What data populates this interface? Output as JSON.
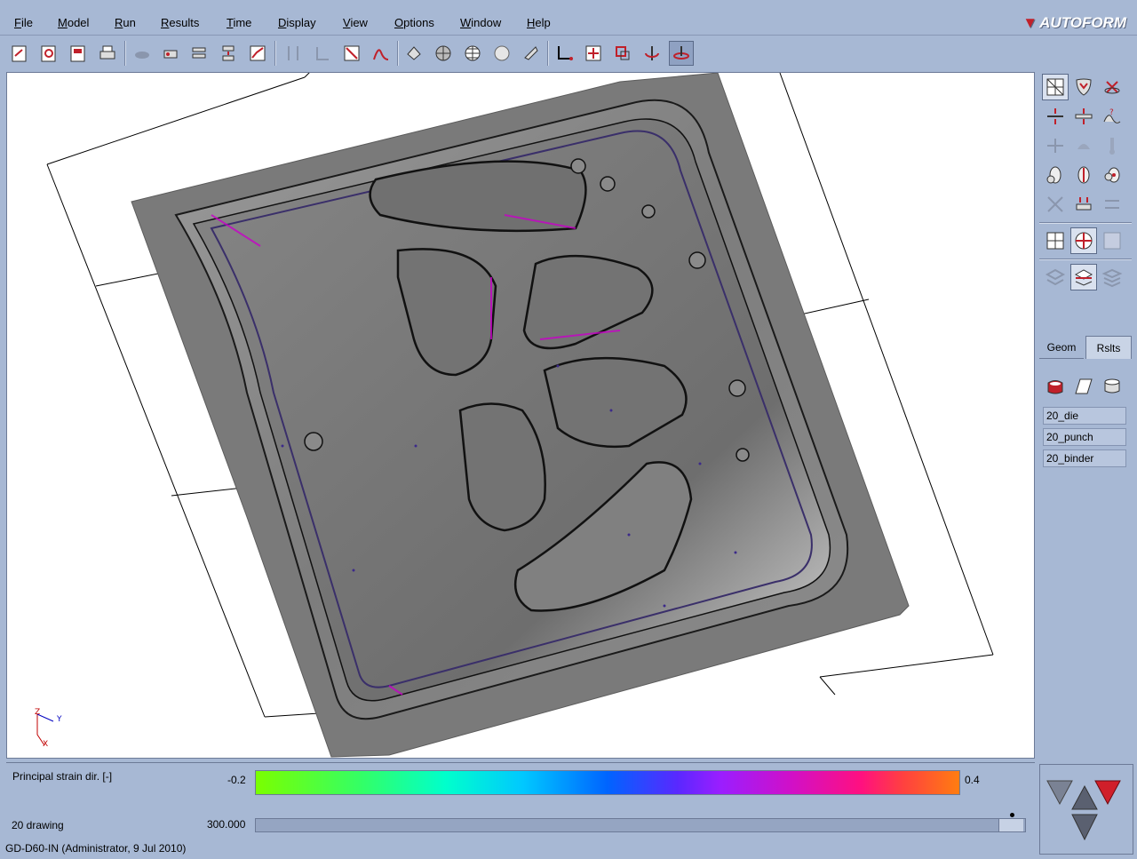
{
  "menu": {
    "file": "ile",
    "file_u": "F",
    "model": "odel",
    "model_u": "M",
    "run": "un",
    "run_u": "R",
    "results": "esults",
    "results_u": "R",
    "time": "ime",
    "time_u": "T",
    "display": "isplay",
    "display_u": "D",
    "view": "iew",
    "view_u": "V",
    "options": "ptions",
    "options_u": "O",
    "window": "indow",
    "window_u": "W",
    "help": "elp",
    "help_u": "H"
  },
  "logo": {
    "text": "AUTOFORM"
  },
  "side": {
    "tab_geom": "Geom",
    "tab_rslts": "Rslts",
    "objects": [
      "20_die",
      "20_punch",
      "20_binder"
    ]
  },
  "bottom": {
    "result_label": "Principal strain dir. [-]",
    "range_min": "-0.2",
    "range_max": "0.4",
    "stage_label": "20 drawing",
    "stage_value": "300.000"
  },
  "axes": {
    "z": "Z",
    "y": "Y",
    "x": "X"
  },
  "status": {
    "text": "GD-D60-IN (Administrator,  9 Jul 2010)"
  },
  "colors": {
    "accent": "#c0202a",
    "panel": "#a7b8d4",
    "viewport": "#ffffff"
  }
}
